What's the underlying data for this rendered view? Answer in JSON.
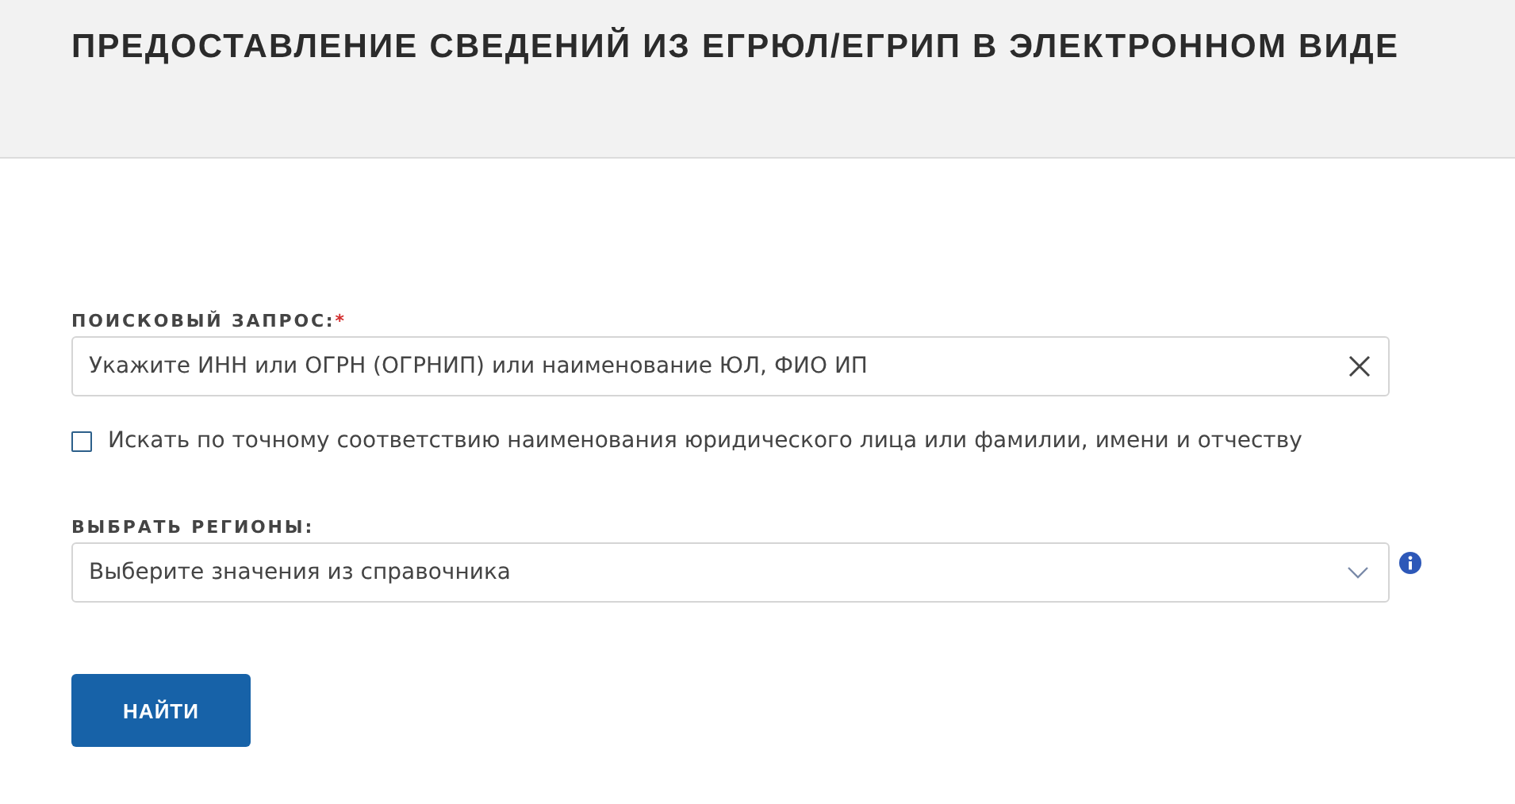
{
  "header": {
    "title": "ПРЕДОСТАВЛЕНИЕ СВЕДЕНИЙ ИЗ ЕГРЮЛ/ЕГРИП В ЭЛЕКТРОННОМ ВИДЕ"
  },
  "search": {
    "label": "ПОИСКОВЫЙ ЗАПРОС:",
    "required_mark": "*",
    "placeholder": "Укажите ИНН или ОГРН (ОГРНИП) или наименование ЮЛ, ФИО ИП"
  },
  "exact_match": {
    "label": "Искать по точному соответствию наименования юридического лица или фамилии, имени и отчеству",
    "checked": false
  },
  "regions": {
    "label": "ВЫБРАТЬ РЕГИОНЫ:",
    "placeholder": "Выберите значения из справочника"
  },
  "submit": {
    "label": "НАЙТИ"
  }
}
